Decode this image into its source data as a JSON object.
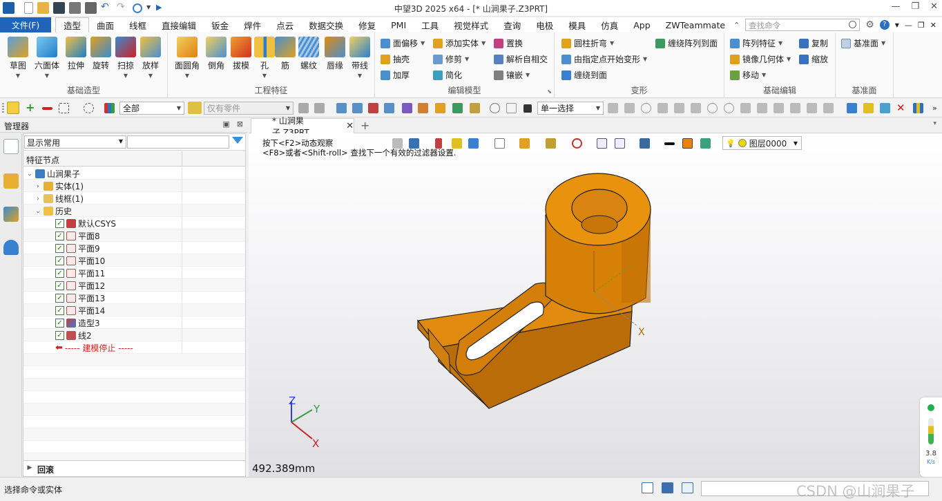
{
  "window": {
    "title": "中望3D 2025 x64 - [* 山涧果子.Z3PRT]"
  },
  "menu": {
    "file": "文件(F)",
    "tabs": [
      "造型",
      "曲面",
      "线框",
      "直接编辑",
      "钣金",
      "焊件",
      "点云",
      "数据交换",
      "修复",
      "PMI",
      "工具",
      "视觉样式",
      "查询",
      "电极",
      "模具",
      "仿真",
      "App",
      "ZWTeammate"
    ],
    "active_tab": "造型",
    "search_placeholder": "查找命令"
  },
  "ribbon": {
    "basic_shape": {
      "name": "基础造型",
      "buttons": [
        "草图",
        "六面体",
        "拉伸",
        "旋转",
        "扫掠",
        "放样"
      ]
    },
    "eng_features": {
      "name": "工程特征",
      "buttons": [
        "面圆角",
        "倒角",
        "拔模",
        "孔",
        "筋",
        "螺纹",
        "唇缘",
        "带线"
      ]
    },
    "edit_model": {
      "name": "编辑模型",
      "items": [
        "面偏移",
        "抽壳",
        "加厚",
        "添加实体",
        "修剪",
        "简化",
        "置换",
        "解析自相交",
        "镶嵌"
      ]
    },
    "deform": {
      "name": "变形",
      "items": [
        "圆柱折弯",
        "由指定点开始变形",
        "缠绕到面",
        "缠绕阵列到面"
      ]
    },
    "basic_edit": {
      "name": "基础编辑",
      "items": [
        "阵列特征",
        "镜像几何体",
        "移动",
        "复制",
        "缩放"
      ]
    },
    "datum": {
      "name": "基准面",
      "items": [
        "基准面"
      ]
    }
  },
  "toolbar": {
    "filter_all": "全部",
    "parts_only": "仅有零件",
    "select_mode": "单一选择"
  },
  "manager": {
    "title": "管理器",
    "display_filter": "显示常用",
    "column_header": "特征节点",
    "root": "山涧果子",
    "solid": "实体(1)",
    "wire": "线框(1)",
    "history": "历史",
    "history_items": [
      "默认CSYS",
      "平面8",
      "平面9",
      "平面10",
      "平面11",
      "平面12",
      "平面13",
      "平面14",
      "造型3",
      "线2"
    ],
    "stop_line": "----- 建模停止 -----",
    "rollback": "回滚"
  },
  "document": {
    "tab": "* 山涧果子.Z3PRT",
    "hint1": "按下<F2>动态观察",
    "hint2": "<F8>或者<Shift-roll> 查找下一个有效的过滤器设置.",
    "layer": "图层0000",
    "measure": "492.389mm",
    "axis_x": "X",
    "axis_y": "Y",
    "axis_z": "Z",
    "meter_value": "3.8",
    "meter_unit": "K/s"
  },
  "status": {
    "text": "选择命令或实体",
    "watermark": "CSDN @山涧果子"
  },
  "colors": {
    "accent": "#1f64b8",
    "model": "#e08a10",
    "model_dark": "#b86a08"
  }
}
